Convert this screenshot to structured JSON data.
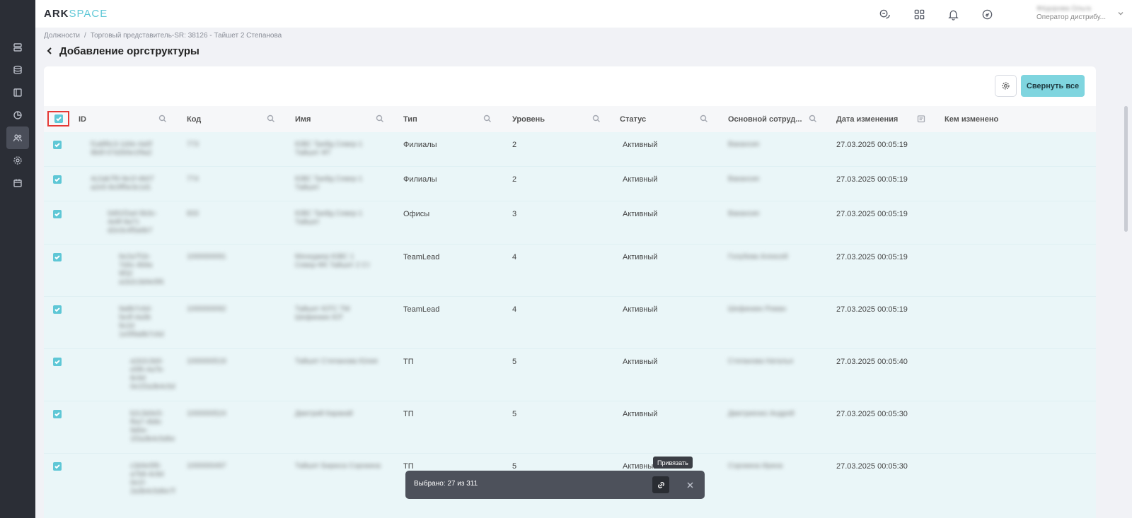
{
  "app": {
    "logo_part1": "ARK",
    "logo_part2": "SPACE"
  },
  "user": {
    "name": "Фёдорова Ольга",
    "role": "Оператор дистрибу..."
  },
  "breadcrumb": {
    "item1": "Должности",
    "separator": "/",
    "item2": "Торговый представитель-SR: 38126 - Тайшет 2 Степанова"
  },
  "page": {
    "title": "Добавление оргструктуры"
  },
  "toolbar": {
    "collapse_label": "Свернуть все"
  },
  "table": {
    "columns": [
      "ID",
      "Код",
      "Имя",
      "Тип",
      "Уровень",
      "Статус",
      "Основной сотруд...",
      "Дата изменения",
      "Кем изменено"
    ],
    "rows": [
      {
        "id": "f1a8f6c3-1d4e-4a0f 9b6f-07d2b5e1f9a2",
        "code": "773",
        "name": "ЮВС Трейд Север-1 Тайшет ФТ",
        "type": "Филиалы",
        "level": "2",
        "status": "Активный",
        "employee": "Вакансия",
        "date": "27.03.2025 00:05:19",
        "changed_by": ""
      },
      {
        "id": "4c2ab7f0-9e1f-4b07 a2e5-8c0ff5e3c1d1",
        "code": "774",
        "name": "ЮВС Трейд Север-1 Тайшет",
        "type": "Филиалы",
        "level": "2",
        "status": "Активный",
        "employee": "Вакансия",
        "date": "27.03.2025 00:05:19",
        "changed_by": ""
      },
      {
        "id": "0d91f2a4-5b3c-4e8f-9a71 d2e3c4f5a6b7",
        "code": "833",
        "name": "ЮВС Трейд Север-1 Тайшет",
        "type": "Офисы",
        "level": "3",
        "status": "Активный",
        "employee": "Вакансия",
        "date": "27.03.2025 00:05:19",
        "changed_by": ""
      },
      {
        "id": "6e2a7f1b-7d4c-4b9a 9f32 a1b2c3d4e5f6",
        "code": "1000000091",
        "name": "Менеджер ЮВС 1 Север-ФК Тайшет 2 Ст",
        "type": "TeamLead",
        "level": "4",
        "status": "Активный",
        "employee": "Голубева Алексей",
        "date": "27.03.2025 00:05:19",
        "changed_by": ""
      },
      {
        "id": "9a8b7c6d-5e4f-4a3b 9c2d 1e0f9a8b7c6d",
        "code": "1000000092",
        "name": "Тайшет ЮТС ТМ Шефинкин ЮТ",
        "type": "TeamLead",
        "level": "4",
        "status": "Активный",
        "employee": "Шефинкин Роман",
        "date": "27.03.2025 00:05:19",
        "changed_by": ""
      },
      {
        "id": "a1b2c3d4-e5f6-4a7b-8c9d 0e1f2a3b4c5d",
        "code": "1000000519",
        "name": "Тайшет Степанова Юлия",
        "type": "ТП",
        "level": "5",
        "status": "Активный",
        "employee": "Степанова Наталья",
        "date": "27.03.2025 00:05:40",
        "changed_by": ""
      },
      {
        "id": "b2c3d4e5-f6a7-4b8c 9d0e-1f2a3b4c5d6e",
        "code": "1000000524",
        "name": "Дмитрий Каракай",
        "type": "ТП",
        "level": "5",
        "status": "Активный",
        "employee": "Дмитриенко Андрей",
        "date": "27.03.2025 00:05:30",
        "changed_by": ""
      },
      {
        "id": "c3d4e5f6-a7b8-4c9d 0e1f-2a3b4c5d6e7f",
        "code": "1000000497",
        "name": "Тайшет Бирюса Сорокина",
        "type": "ТП",
        "level": "5",
        "status": "Активный",
        "employee": "Сорокина Ирина",
        "date": "27.03.2025 00:05:30",
        "changed_by": ""
      }
    ]
  },
  "selection": {
    "text": "Выбрано: 27 из 311",
    "tooltip": "Привязать"
  },
  "icons": {
    "sidebar": [
      "database-stack-icon",
      "database-icon",
      "book-icon",
      "pie-chart-icon",
      "users-icon",
      "settings-icon",
      "calendar-icon"
    ],
    "header": [
      "chat-icon",
      "apps-grid-icon",
      "bell-icon",
      "exchange-icon"
    ]
  },
  "colors": {
    "accent": "#5ec7d6",
    "sidebar_bg": "#2b2e36",
    "row_selected_bg": "#eaf6f8",
    "highlight_border": "#e53935"
  }
}
